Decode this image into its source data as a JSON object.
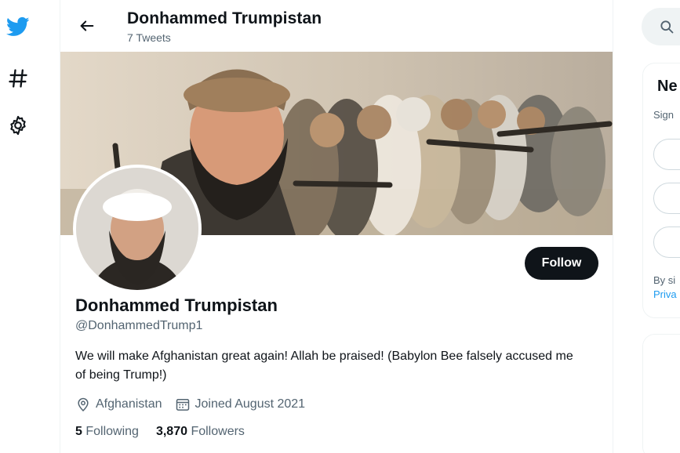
{
  "nav": {
    "icons": [
      "twitter-bird-icon",
      "hashtag-icon",
      "gear-icon"
    ]
  },
  "header": {
    "back_icon": "back-arrow-icon",
    "title": "Donhammed Trumpistan",
    "subtitle": "7 Tweets"
  },
  "profile": {
    "follow_label": "Follow",
    "name": "Donhammed Trumpistan",
    "handle": "@DonhammedTrump1",
    "bio": "We will make Afghanistan great again! Allah be praised! (Babylon Bee falsely accused me of being Trump!)",
    "location": "Afghanistan",
    "joined": "Joined August 2021",
    "following_count": "5",
    "following_label": "Following",
    "followers_count": "3,870",
    "followers_label": "Followers"
  },
  "sidebar": {
    "search_icon": "search-icon",
    "card_title": "Ne",
    "card_sub": "Sign",
    "terms_line1": "By si",
    "terms_line2": "Priva"
  },
  "colors": {
    "accent": "#1d9bf0",
    "text_primary": "#0f1419",
    "text_secondary": "#536471",
    "follow_bg": "#0f1419"
  }
}
